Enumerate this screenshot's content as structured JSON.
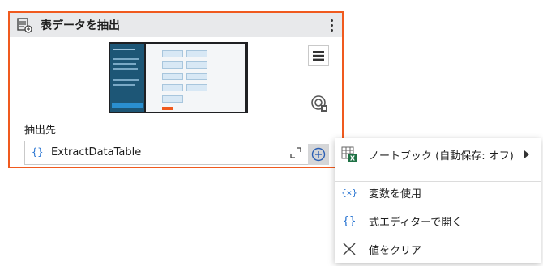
{
  "card": {
    "title": "表データを抽出",
    "field_label": "抽出先",
    "field_prefix": "{}",
    "field_value": "ExtractDataTable"
  },
  "menu": {
    "items": [
      {
        "label": "ノートブック (自動保存: オフ)",
        "icon": "excel-notebook-icon",
        "has_submenu": true
      },
      {
        "label": "変数を使用",
        "icon": "variable-icon"
      },
      {
        "label": "式エディターで開く",
        "icon": "braces-icon"
      },
      {
        "label": "値をクリア",
        "icon": "close-icon"
      }
    ]
  },
  "colors": {
    "selection_border": "#f05a1e",
    "header_bg": "#e8e9eb",
    "accent_blue": "#2b76d2",
    "excel_green": "#1e7145"
  }
}
